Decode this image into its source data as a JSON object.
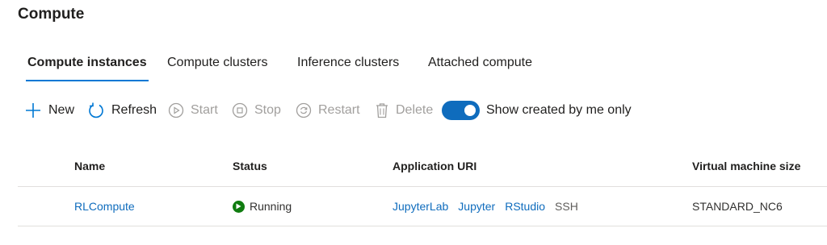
{
  "page": {
    "title": "Compute"
  },
  "tabs": [
    {
      "label": "Compute instances",
      "active": true
    },
    {
      "label": "Compute clusters",
      "active": false
    },
    {
      "label": "Inference clusters",
      "active": false
    },
    {
      "label": "Attached compute",
      "active": false
    }
  ],
  "toolbar": {
    "new_label": "New",
    "refresh_label": "Refresh",
    "start_label": "Start",
    "stop_label": "Stop",
    "restart_label": "Restart",
    "delete_label": "Delete",
    "toggle_label": "Show created by me only",
    "toggle_on": true
  },
  "table": {
    "columns": [
      "Name",
      "Status",
      "Application URI",
      "Virtual machine size"
    ],
    "rows": [
      {
        "name": "RLCompute",
        "status": "Running",
        "uris": [
          "JupyterLab",
          "Jupyter",
          "RStudio",
          "SSH"
        ],
        "vm_size": "STANDARD_NC6"
      }
    ]
  },
  "colors": {
    "accent": "#0078d4",
    "link": "#0f6cbd",
    "running": "#107c10",
    "disabled": "#a19f9d"
  },
  "icons": {
    "new": "plus-icon",
    "refresh": "refresh-icon",
    "start": "play-circle-icon",
    "stop": "stop-circle-icon",
    "restart": "restart-icon",
    "delete": "trash-icon",
    "running": "running-status-icon"
  }
}
